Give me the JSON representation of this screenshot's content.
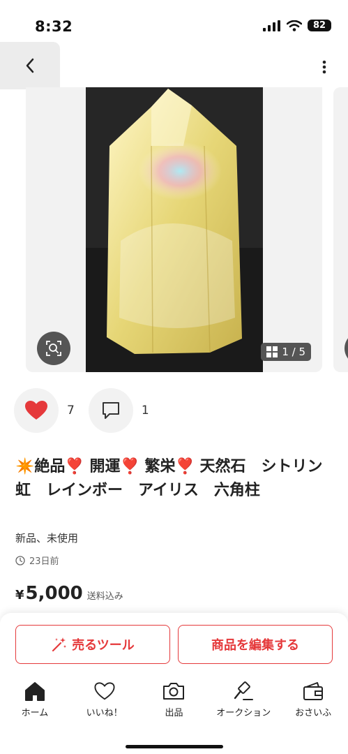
{
  "status_bar": {
    "time": "8:32",
    "battery": "82"
  },
  "carousel": {
    "counter": "1 / 5"
  },
  "reactions": {
    "likes": "7",
    "comments": "1"
  },
  "item": {
    "title": "✴️絶品❣️ 開運❣️ 繁栄❣️ 天然石　シトリン　虹　レインボー　アイリス　六角柱",
    "condition": "新品、未使用",
    "posted": "23日前",
    "currency": "¥",
    "price": "5,000",
    "shipping": "送料込み"
  },
  "actions": {
    "sell_tool": "売るツール",
    "edit_item": "商品を編集する"
  },
  "tabbar": {
    "items": [
      {
        "label": "ホーム",
        "icon": "home-icon"
      },
      {
        "label": "いいね！",
        "icon": "heart-outline-icon"
      },
      {
        "label": "出品",
        "icon": "camera-icon"
      },
      {
        "label": "オークション",
        "icon": "gavel-icon"
      },
      {
        "label": "おさいふ",
        "icon": "wallet-icon"
      }
    ]
  },
  "colors": {
    "accent": "#e5393b",
    "crystal": "#efe39a",
    "backdrop": "#111111"
  }
}
